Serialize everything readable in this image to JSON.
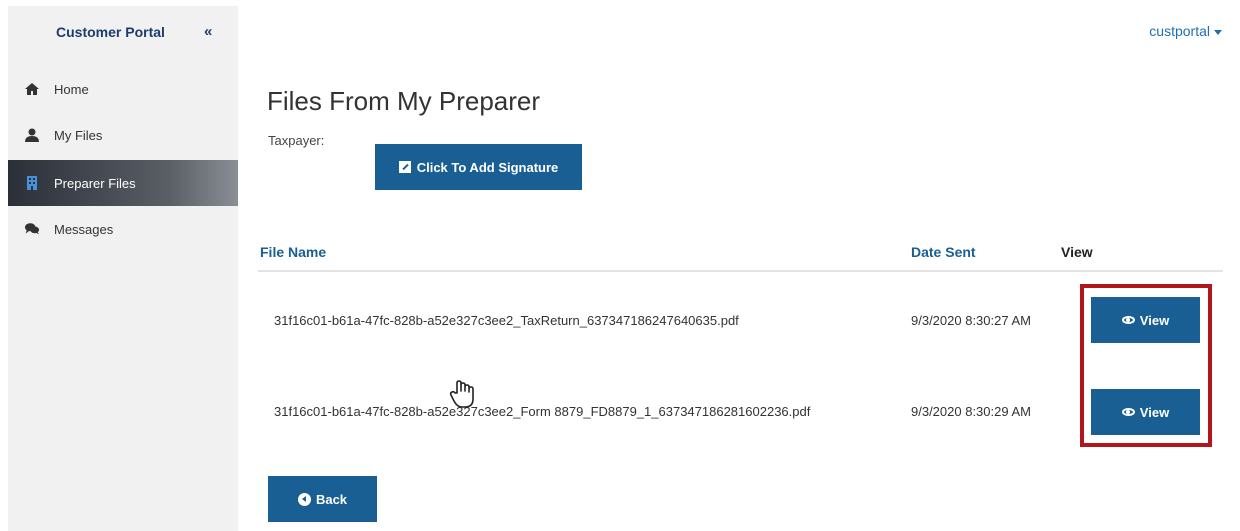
{
  "sidebar": {
    "brand": "Customer Portal",
    "collapse_icon": "«",
    "items": [
      {
        "label": "Home",
        "icon": "home-icon"
      },
      {
        "label": "My Files",
        "icon": "user-icon"
      },
      {
        "label": "Preparer Files",
        "icon": "building-icon",
        "active": true
      },
      {
        "label": "Messages",
        "icon": "chat-icon"
      }
    ]
  },
  "header": {
    "user": "custportal"
  },
  "main": {
    "title": "Files From My Preparer",
    "taxpayer_label": "Taxpayer:",
    "signature_button": "Click To Add Signature",
    "table": {
      "headers": [
        "File Name",
        "Date Sent",
        "View"
      ],
      "rows": [
        {
          "file": "31f16c01-b61a-47fc-828b-a52e327c3ee2_TaxReturn_637347186247640635.pdf",
          "date": "9/3/2020 8:30:27 AM",
          "action": "View"
        },
        {
          "file": "31f16c01-b61a-47fc-828b-a52e327c3ee2_Form 8879_FD8879_1_637347186281602236.pdf",
          "date": "9/3/2020 8:30:29 AM",
          "action": "View"
        }
      ]
    },
    "back_button": "Back"
  },
  "colors": {
    "primary": "#1a5f93",
    "highlight": "#b0161b",
    "link": "#1f6fb2"
  }
}
